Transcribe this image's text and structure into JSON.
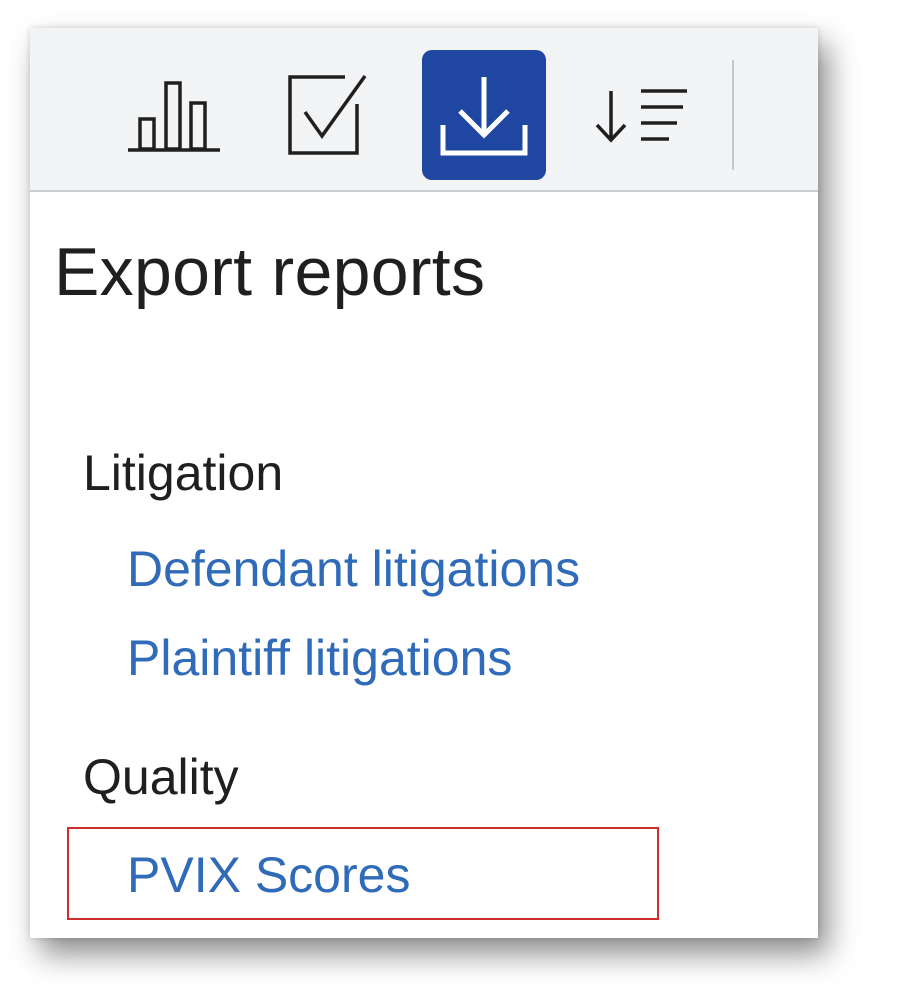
{
  "toolbar": {
    "buttons": [
      {
        "icon": "bar-chart-icon",
        "active": false
      },
      {
        "icon": "checkbox-icon",
        "active": false
      },
      {
        "icon": "download-icon",
        "active": true
      },
      {
        "icon": "sort-descending-icon",
        "active": false
      }
    ],
    "active_color": "#1f46a0"
  },
  "panel": {
    "title": "Export reports",
    "sections": [
      {
        "heading": "Litigation",
        "links": [
          "Defendant litigations",
          "Plaintiff litigations"
        ]
      },
      {
        "heading": "Quality",
        "links": [
          "PVIX Scores"
        ]
      }
    ],
    "link_color": "#2f6bb8",
    "highlighted_link": "PVIX Scores",
    "highlight_color": "#cc2e2e"
  }
}
